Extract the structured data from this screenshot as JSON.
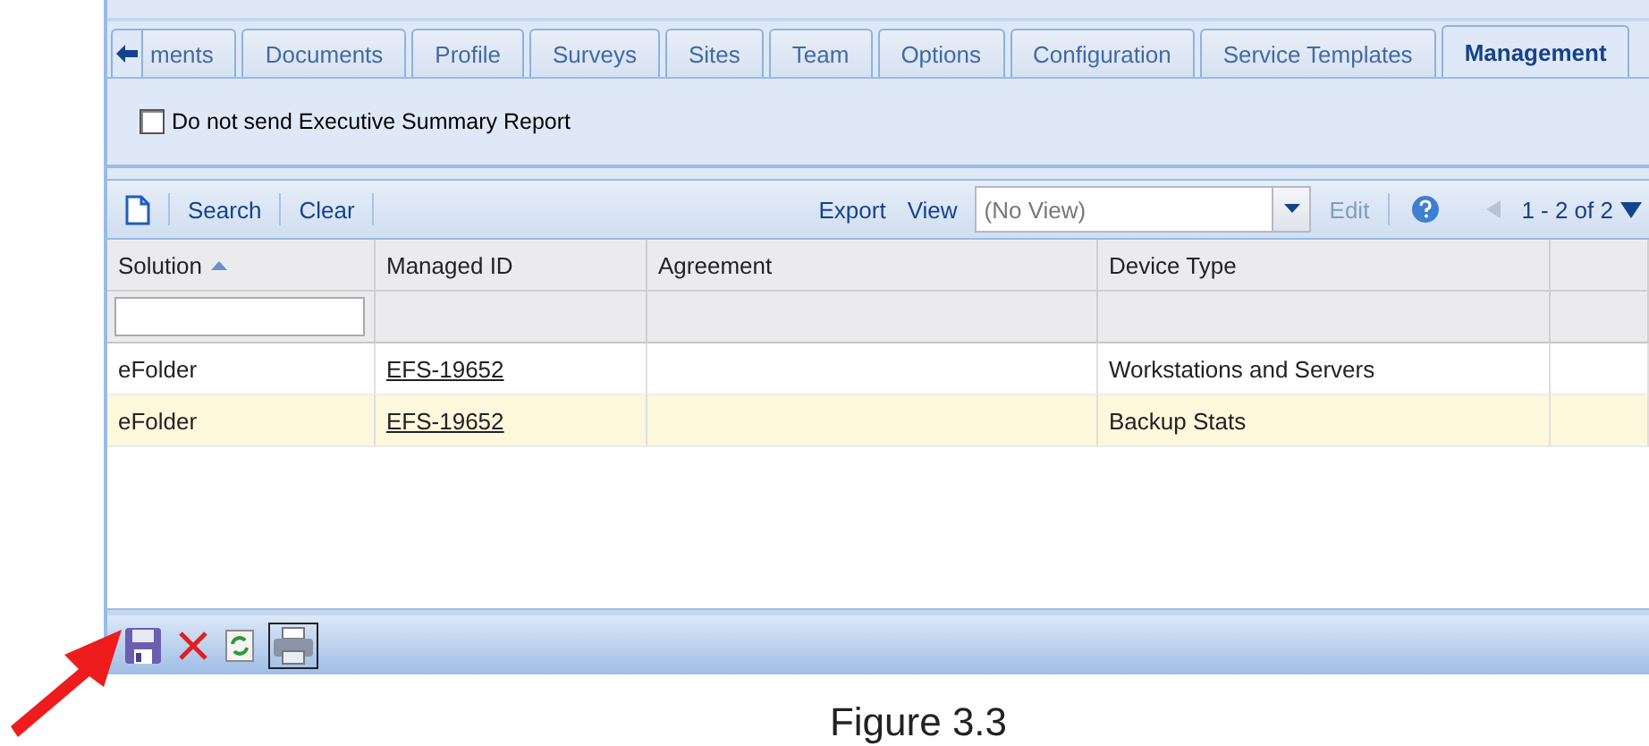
{
  "tabs": [
    {
      "label": "ments",
      "selected": false
    },
    {
      "label": "Documents",
      "selected": false
    },
    {
      "label": "Profile",
      "selected": false
    },
    {
      "label": "Surveys",
      "selected": false
    },
    {
      "label": "Sites",
      "selected": false
    },
    {
      "label": "Team",
      "selected": false
    },
    {
      "label": "Options",
      "selected": false
    },
    {
      "label": "Configuration",
      "selected": false
    },
    {
      "label": "Service Templates",
      "selected": false
    },
    {
      "label": "Management",
      "selected": true
    }
  ],
  "option": {
    "label": "Do not send Executive Summary Report",
    "checked": false
  },
  "toolbar": {
    "search": "Search",
    "clear": "Clear",
    "export": "Export",
    "view_label": "View",
    "view_value": "(No View)",
    "edit": {
      "label": "Edit",
      "disabled": true
    },
    "paging": "1 - 2 of 2"
  },
  "table": {
    "columns": [
      {
        "label": "Solution",
        "sort_ascending": true
      },
      {
        "label": "Managed ID",
        "sort_ascending": false
      },
      {
        "label": "Agreement",
        "sort_ascending": false
      },
      {
        "label": "Device Type",
        "sort_ascending": false
      },
      {
        "sort_ascending": false
      }
    ],
    "rows": [
      {
        "selected": false,
        "cells": [
          "eFolder",
          "EFS-19652",
          "",
          "Workstations and Servers"
        ]
      },
      {
        "selected": true,
        "cells": [
          "eFolder",
          "EFS-19652",
          "",
          "Backup Stats"
        ]
      }
    ]
  },
  "caption": "Figure 3.3"
}
